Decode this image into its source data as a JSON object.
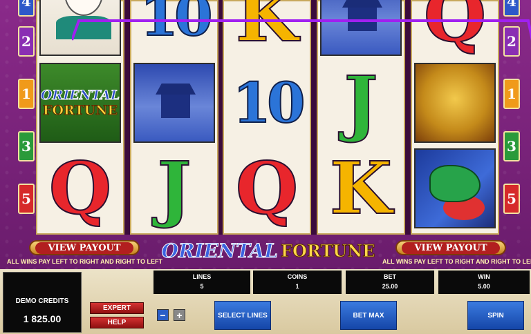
{
  "game": {
    "title_part1": "ORIENTAL",
    "title_part2": "FORTUNE"
  },
  "reels": [
    [
      "geisha",
      "oriental-fortune-logo",
      "Q"
    ],
    [
      "10",
      "temple",
      "J"
    ],
    [
      "K",
      "10",
      "Q"
    ],
    [
      "temple",
      "J",
      "K"
    ],
    [
      "Q",
      "lion-dog",
      "dragon"
    ]
  ],
  "logo_symbol": {
    "line1": "ORIENTAL",
    "line2": "FORTUNE"
  },
  "paylines_left": [
    "4",
    "2",
    "1",
    "3",
    "5"
  ],
  "paylines_right": [
    "4",
    "2",
    "1",
    "3",
    "5"
  ],
  "buttons": {
    "view_payout_left": "VIEW PAYOUT",
    "view_payout_right": "VIEW PAYOUT",
    "expert": "EXPERT",
    "help": "HELP",
    "minus": "−",
    "plus": "+",
    "select_lines": "SELECT LINES",
    "bet_max": "BET MAX",
    "spin": "SPIN"
  },
  "notes": {
    "left": "ALL WINS PAY LEFT TO RIGHT AND RIGHT TO LEFT",
    "right": "ALL WINS PAY LEFT TO RIGHT AND RIGHT TO LEFT"
  },
  "credits": {
    "label": "DEMO CREDITS",
    "value": "1 825.00"
  },
  "panels": {
    "lines": {
      "label": "LINES",
      "value": "5"
    },
    "coins": {
      "label": "COINS",
      "value": "1"
    },
    "bet": {
      "label": "BET",
      "value": "25.00"
    },
    "win": {
      "label": "WIN",
      "value": "5.00"
    }
  },
  "colors": {
    "payline": "#a020f0",
    "background": "#7a2277",
    "button_blue": "#1f5cc7",
    "button_red": "#c21f1f"
  }
}
